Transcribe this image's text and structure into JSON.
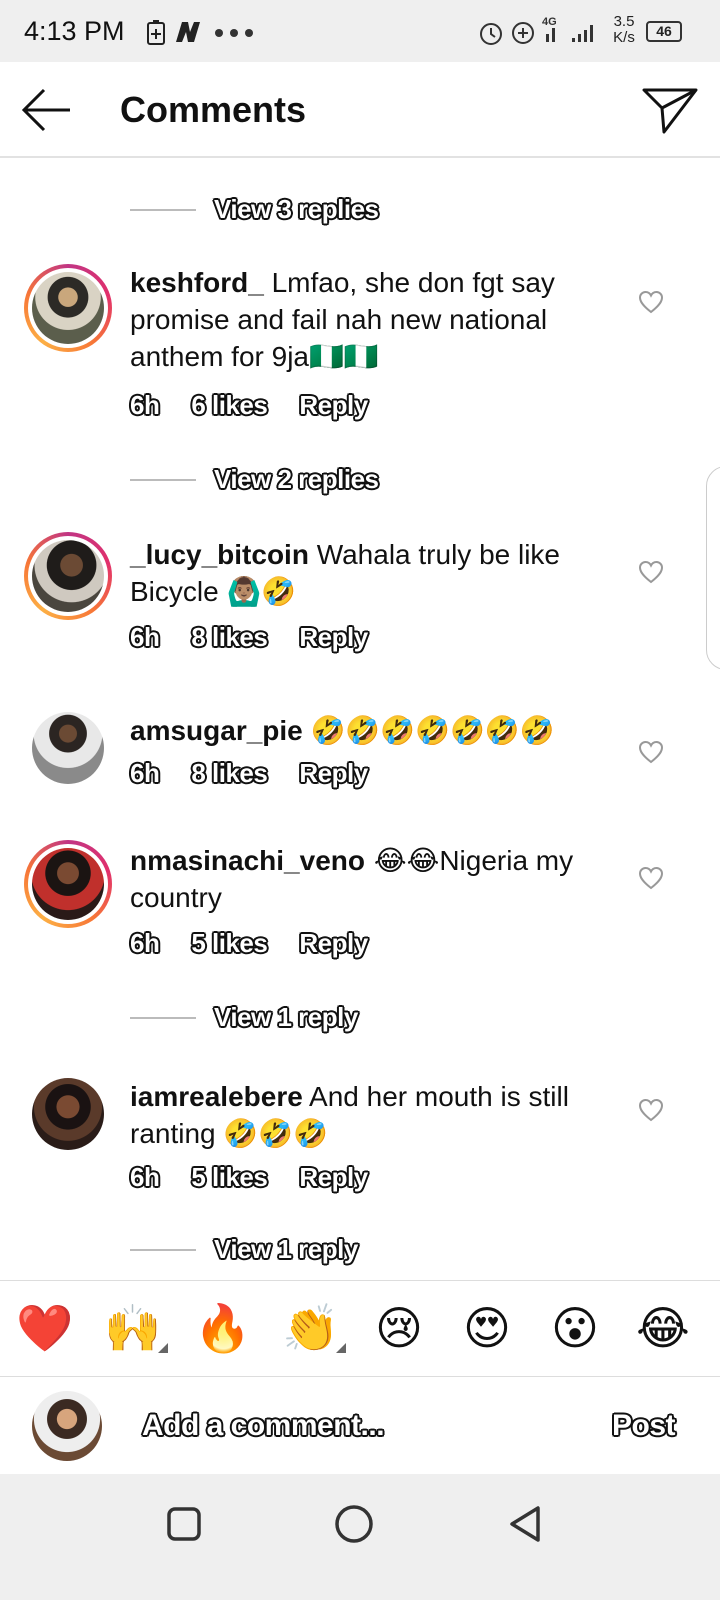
{
  "status_bar": {
    "time": "4:13 PM",
    "network_label": "4G",
    "speed_value": "3.5",
    "speed_unit": "K/s",
    "battery": "46"
  },
  "header": {
    "title": "Comments"
  },
  "threads": [
    {
      "view_replies": "View 3 replies"
    },
    {
      "username": "keshford_",
      "text": " Lmfao, she don fgt say promise and fail nah new national anthem for 9ja",
      "text_emoji": "🇳🇬🇳🇬",
      "time": "6h",
      "likes": "6 likes",
      "reply": "Reply",
      "view_replies": "View 2 replies"
    },
    {
      "username": "_lucy_bitcoin",
      "text": " Wahala truly be like Bicycle ",
      "text_emoji": "🙆🏽‍♂️🤣",
      "time": "6h",
      "likes": "8 likes",
      "reply": "Reply"
    },
    {
      "username": "amsugar_pie",
      "text": " ",
      "text_emoji": "🤣🤣🤣🤣🤣🤣🤣",
      "time": "6h",
      "likes": "8 likes",
      "reply": "Reply"
    },
    {
      "username": "nmasinachi_veno",
      "text_emoji": " 😂😂",
      "text": "Nigeria my country",
      "time": "6h",
      "likes": "5 likes",
      "reply": "Reply",
      "view_replies": "View 1 reply"
    },
    {
      "username": "iamrealebere",
      "text": " And her mouth is still ranting ",
      "text_emoji": "🤣🤣🤣",
      "time": "6h",
      "likes": "5 likes",
      "reply": "Reply",
      "view_replies": "View 1 reply"
    }
  ],
  "reactions": [
    "❤️",
    "🙌",
    "🔥",
    "👏",
    "😢",
    "😍",
    "😮",
    "😂"
  ],
  "comment_input": {
    "placeholder": "Add a comment...",
    "post_label": "Post"
  },
  "colors": {
    "heart_red": "#e0245e",
    "ring_gradient": "#c13584",
    "separator": "#e2e2e2"
  }
}
